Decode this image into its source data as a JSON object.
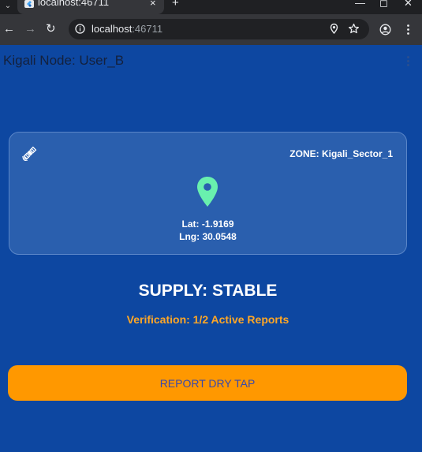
{
  "browser": {
    "tab_title": "localhost:46711",
    "url_host": "localhost",
    "url_port": ":46711",
    "new_tab": "+",
    "close": "×"
  },
  "app": {
    "title": "Kigali Node: User_B"
  },
  "location_card": {
    "zone": "ZONE: Kigali_Sector_1",
    "lat": "Lat: -1.9169",
    "lng": "Lng: 30.0548"
  },
  "status": {
    "supply": "SUPPLY: STABLE",
    "verification": "Verification: 1/2 Active Reports"
  },
  "actions": {
    "report_label": "REPORT DRY TAP"
  },
  "colors": {
    "background": "#0d47a1",
    "card": "#2a5fae",
    "pin": "#69f0ae",
    "accent": "#ff9800",
    "warning_text": "#ffa726"
  }
}
